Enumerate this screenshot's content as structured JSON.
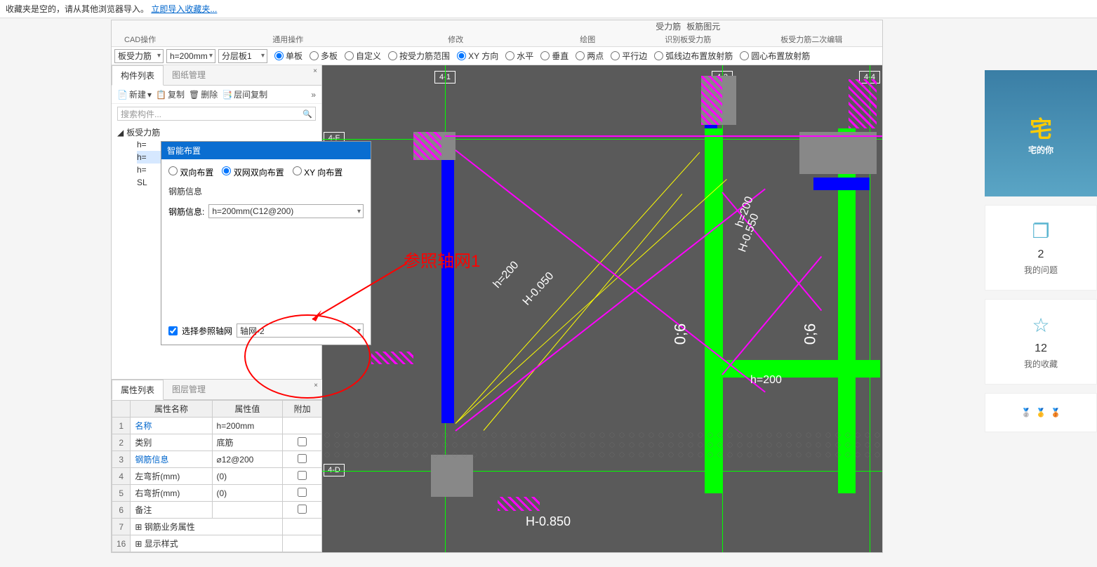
{
  "browser": {
    "msg": "收藏夹是空的，请从其他浏览器导入。 ",
    "link": "立即导入收藏夹..."
  },
  "ribbon": {
    "groups": [
      {
        "label": "CAD操作",
        "items": [
          "CAD操作 ▾"
        ]
      },
      {
        "label": "通用操作",
        "items": [
          "通用操作 ▾"
        ]
      },
      {
        "label": "修改",
        "items": [
          "修改 ▾"
        ]
      },
      {
        "label": "绘图",
        "items": [
          "绘图 ▾"
        ]
      },
      {
        "label": "识别板受力筋",
        "items": [
          "受力筋",
          "板筋图元",
          "识别板受力筋"
        ]
      },
      {
        "label": "板受力筋二次编辑",
        "items": [
          ""
        ]
      }
    ]
  },
  "toolbar": {
    "dd1": "板受力筋",
    "dd2": "h=200mm",
    "dd3": "分层板1",
    "radios": [
      "单板",
      "多板",
      "自定义",
      "按受力筋范围",
      "XY 方向",
      "水平",
      "垂直",
      "两点",
      "平行边",
      "弧线边布置放射筋",
      "圆心布置放射筋"
    ]
  },
  "leftPanel": {
    "tabs": [
      "构件列表",
      "图纸管理"
    ],
    "tools": [
      "新建",
      "复制",
      "删除",
      "层间复制"
    ],
    "searchPlaceholder": "搜索构件...",
    "treeRoot": "板受力筋",
    "treeItems": [
      "h=",
      "h=",
      "h=",
      "SL"
    ]
  },
  "dialog": {
    "title": "智能布置",
    "radios": [
      "双向布置",
      "双网双向布置",
      "XY 向布置"
    ],
    "fieldsetLabel": "钢筋信息",
    "infoLabel": "钢筋信息:",
    "infoValue": "h=200mm(C12@200)",
    "chkLabel": "选择参照轴网",
    "chkValue": "轴网-2"
  },
  "propPanel": {
    "tabs": [
      "属性列表",
      "图层管理"
    ],
    "headers": [
      "属性名称",
      "属性值",
      "附加"
    ],
    "rows": [
      {
        "n": "1",
        "name": "名称",
        "val": "h=200mm",
        "chk": false,
        "link": true
      },
      {
        "n": "2",
        "name": "类别",
        "val": "底筋",
        "chk": true,
        "link": false
      },
      {
        "n": "3",
        "name": "钢筋信息",
        "val": "⌀12@200",
        "chk": true,
        "link": true
      },
      {
        "n": "4",
        "name": "左弯折(mm)",
        "val": "(0)",
        "chk": true,
        "link": false
      },
      {
        "n": "5",
        "name": "右弯折(mm)",
        "val": "(0)",
        "chk": true,
        "link": false
      },
      {
        "n": "6",
        "name": "备注",
        "val": "",
        "chk": true,
        "link": false
      },
      {
        "n": "7",
        "name": "⊞ 钢筋业务属性",
        "val": "",
        "chk": false,
        "link": false
      },
      {
        "n": "16",
        "name": "⊞ 显示样式",
        "val": "",
        "chk": false,
        "link": false
      }
    ]
  },
  "annotation": "参照轴网1",
  "canvasLabels": {
    "axes": [
      "4-1",
      "4-2",
      "4-4",
      "4-F",
      "4-D"
    ],
    "dims": [
      "h=200",
      "H-0.050",
      "0;6",
      "H-0.550",
      "h=200",
      "0;6",
      "h=200",
      "H-0.850"
    ]
  },
  "sidebar": {
    "promo": "宅的你",
    "cards": [
      {
        "num": "2",
        "label": "我的问题",
        "icon": "❐"
      },
      {
        "num": "12",
        "label": "我的收藏",
        "icon": "☆"
      }
    ],
    "medals": [
      "🥈",
      "🥇",
      "🥉"
    ]
  }
}
